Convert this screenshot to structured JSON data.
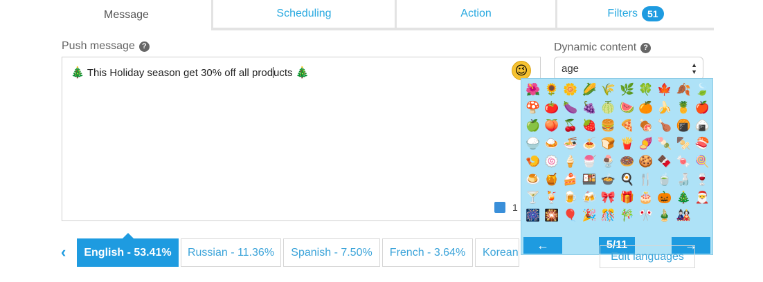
{
  "tabs": [
    {
      "label": "Message"
    },
    {
      "label": "Scheduling"
    },
    {
      "label": "Action"
    },
    {
      "label": "Filters",
      "badge": "51"
    }
  ],
  "push_message": {
    "label": "Push message",
    "text_before": "This Holiday season get 30% off all prod",
    "text_after": "ucts",
    "tree_emoji": "🎄",
    "emoji_toggle": "😉",
    "counter": "1"
  },
  "dynamic_content": {
    "label": "Dynamic content",
    "selected": "age"
  },
  "emoji_picker": {
    "page": "5/11",
    "prev_label": "←",
    "next_label": "→",
    "emojis": [
      "🌺",
      "🌻",
      "🌼",
      "🌽",
      "🌾",
      "🌿",
      "🍀",
      "🍁",
      "🍂",
      "🍃",
      "🍄",
      "🍅",
      "🍆",
      "🍇",
      "🍈",
      "🍉",
      "🍊",
      "🍌",
      "🍍",
      "🍎",
      "🍏",
      "🍑",
      "🍒",
      "🍓",
      "🍔",
      "🍕",
      "🍖",
      "🍗",
      "🍘",
      "🍙",
      "🍚",
      "🍛",
      "🍜",
      "🍝",
      "🍞",
      "🍟",
      "🍠",
      "🍡",
      "🍢",
      "🍣",
      "🍤",
      "🍥",
      "🍦",
      "🍧",
      "🍨",
      "🍩",
      "🍪",
      "🍫",
      "🍬",
      "🍭",
      "🍮",
      "🍯",
      "🍰",
      "🍱",
      "🍲",
      "🍳",
      "🍴",
      "🍵",
      "🍶",
      "🍷",
      "🍸",
      "🍹",
      "🍺",
      "🍻",
      "🎀",
      "🎁",
      "🎂",
      "🎃",
      "🎄",
      "🎅",
      "🎆",
      "🎇",
      "🎈",
      "🎉",
      "🎊",
      "🎋",
      "🎌",
      "🎍",
      "🎎"
    ]
  },
  "languages": {
    "items": [
      {
        "label": "English - 53.41%"
      },
      {
        "label": "Russian - 11.36%"
      },
      {
        "label": "Spanish - 7.50%"
      },
      {
        "label": "French - 3.64%"
      },
      {
        "label": "Korean"
      }
    ],
    "edit_label": "Edit languages"
  }
}
